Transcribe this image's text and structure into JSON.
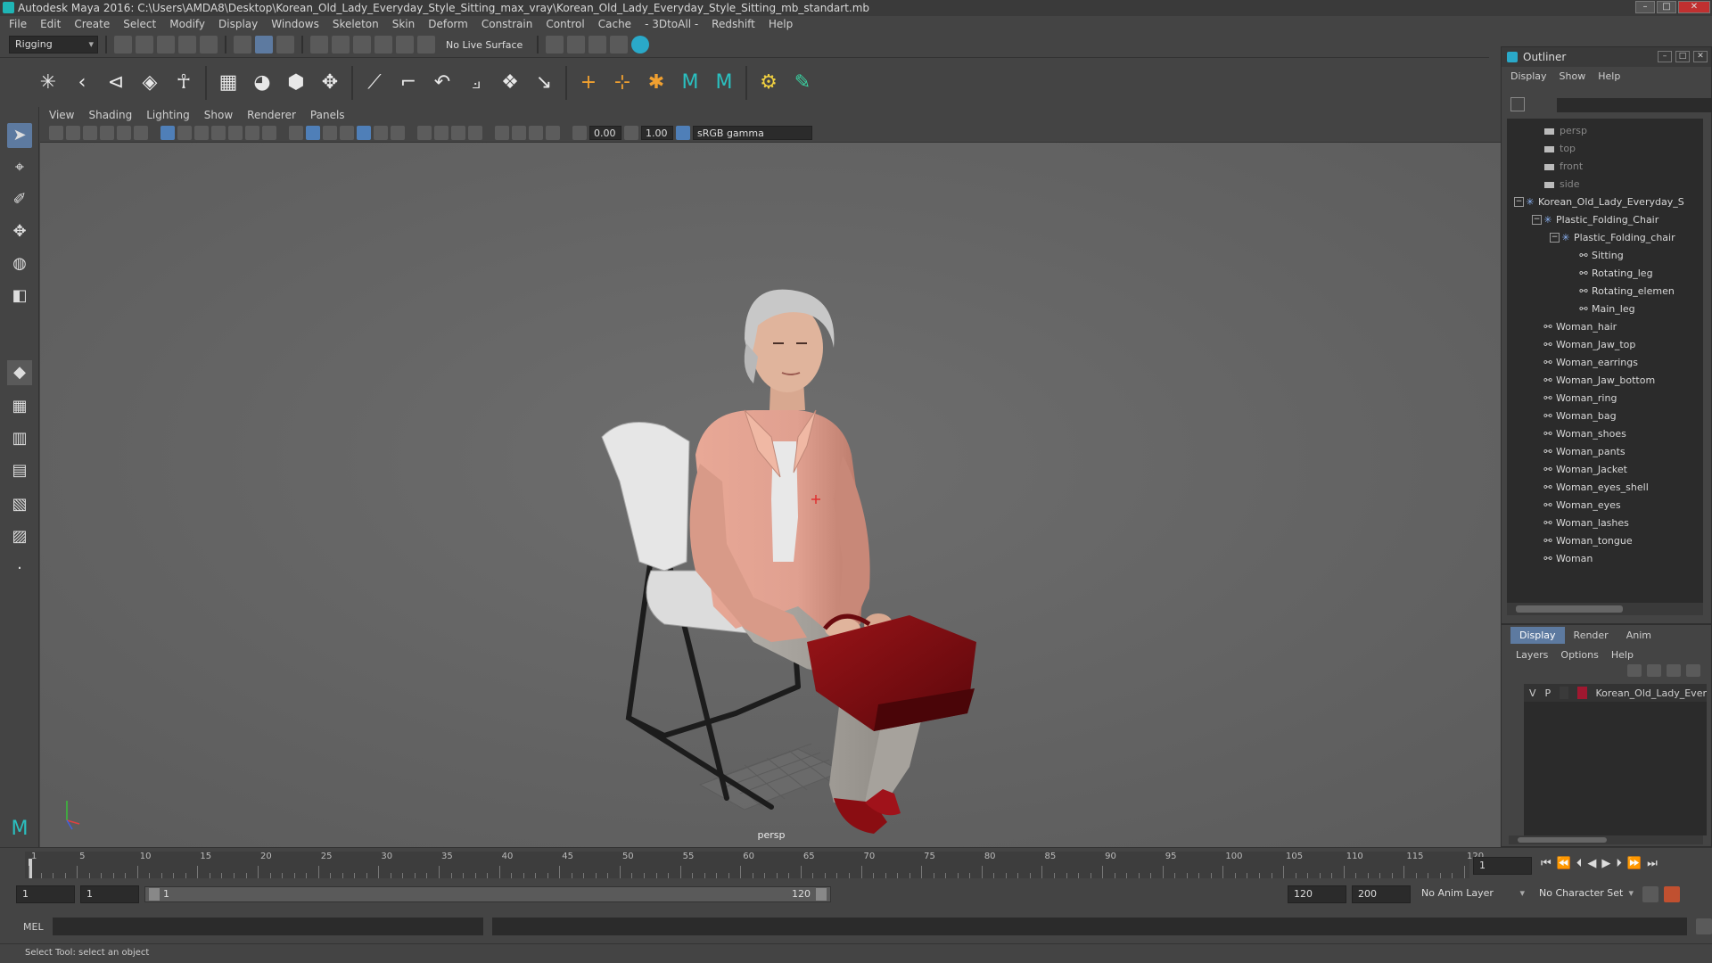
{
  "window": {
    "title": "Autodesk Maya 2016: C:\\Users\\AMDA8\\Desktop\\Korean_Old_Lady_Everyday_Style_Sitting_max_vray\\Korean_Old_Lady_Everyday_Style_Sitting_mb_standart.mb"
  },
  "menubar": [
    "File",
    "Edit",
    "Create",
    "Select",
    "Modify",
    "Display",
    "Windows",
    "Skeleton",
    "Skin",
    "Deform",
    "Constrain",
    "Control",
    "Cache",
    "- 3DtoAll -",
    "Redshift",
    "Help"
  ],
  "status": {
    "mode": "Rigging",
    "live_surface": "No Live Surface"
  },
  "viewport": {
    "menu": [
      "View",
      "Shading",
      "Lighting",
      "Show",
      "Renderer",
      "Panels"
    ],
    "exposure": "0.00",
    "gamma": "1.00",
    "color_space": "sRGB gamma",
    "camera_label": "persp"
  },
  "timeline": {
    "ticks": [
      "1",
      "5",
      "10",
      "15",
      "20",
      "25",
      "30",
      "35",
      "40",
      "45",
      "50",
      "55",
      "60",
      "65",
      "70",
      "75",
      "80",
      "85",
      "90",
      "95",
      "100",
      "105",
      "110",
      "115",
      "120"
    ],
    "current_frame": "1"
  },
  "range": {
    "start": "1",
    "playback_start": "1",
    "slider_start": "1",
    "slider_end": "120",
    "playback_end": "120",
    "end": "200",
    "anim_layer": "No Anim Layer",
    "char_set": "No Character Set"
  },
  "mel": {
    "label": "MEL"
  },
  "helpline": "Select Tool: select an object",
  "outliner": {
    "title": "Outliner",
    "menu": [
      "Display",
      "Show",
      "Help"
    ],
    "items": [
      {
        "label": "persp",
        "type": "camera"
      },
      {
        "label": "top",
        "type": "camera"
      },
      {
        "label": "front",
        "type": "camera"
      },
      {
        "label": "side",
        "type": "camera"
      },
      {
        "label": "Korean_Old_Lady_Everyday_S",
        "type": "group"
      },
      {
        "label": "Plastic_Folding_Chair",
        "type": "group"
      },
      {
        "label": "Plastic_Folding_chair",
        "type": "group"
      },
      {
        "label": "Sitting",
        "type": "mesh"
      },
      {
        "label": "Rotating_leg",
        "type": "mesh"
      },
      {
        "label": "Rotating_elemen",
        "type": "mesh"
      },
      {
        "label": "Main_leg",
        "type": "mesh"
      },
      {
        "label": "Woman_hair",
        "type": "mesh"
      },
      {
        "label": "Woman_Jaw_top",
        "type": "mesh"
      },
      {
        "label": "Woman_earrings",
        "type": "mesh"
      },
      {
        "label": "Woman_Jaw_bottom",
        "type": "mesh"
      },
      {
        "label": "Woman_ring",
        "type": "mesh"
      },
      {
        "label": "Woman_bag",
        "type": "mesh"
      },
      {
        "label": "Woman_shoes",
        "type": "mesh"
      },
      {
        "label": "Woman_pants",
        "type": "mesh"
      },
      {
        "label": "Woman_Jacket",
        "type": "mesh"
      },
      {
        "label": "Woman_eyes_shell",
        "type": "mesh"
      },
      {
        "label": "Woman_eyes",
        "type": "mesh"
      },
      {
        "label": "Woman_lashes",
        "type": "mesh"
      },
      {
        "label": "Woman_tongue",
        "type": "mesh"
      },
      {
        "label": "Woman",
        "type": "mesh"
      }
    ]
  },
  "layers": {
    "tabs": [
      "Display",
      "Render",
      "Anim"
    ],
    "menu": [
      "Layers",
      "Options",
      "Help"
    ],
    "row": {
      "v": "V",
      "p": "P",
      "name": "Korean_Old_Lady_Ever",
      "color": "#a01830"
    }
  }
}
